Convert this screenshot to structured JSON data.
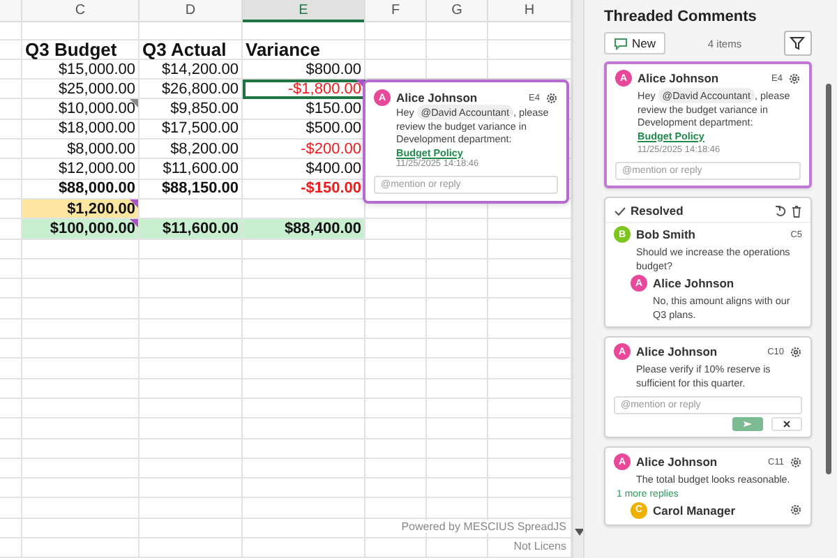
{
  "sheet": {
    "columns": [
      {
        "label": "C",
        "selected": false
      },
      {
        "label": "D",
        "selected": false
      },
      {
        "label": "E",
        "selected": true
      },
      {
        "label": "F",
        "selected": false
      },
      {
        "label": "G",
        "selected": false
      },
      {
        "label": "H",
        "selected": false
      }
    ],
    "rows": [
      {
        "kind": "title",
        "cells": [
          {
            "text": "Q3 Budget"
          },
          {
            "text": "Q3 Actual"
          },
          {
            "text": "Variance"
          }
        ]
      },
      {
        "kind": "data",
        "cells": [
          {
            "text": "$15,000.00"
          },
          {
            "text": "$14,200.00"
          },
          {
            "text": "$800.00"
          }
        ]
      },
      {
        "kind": "data",
        "cells": [
          {
            "text": "$25,000.00"
          },
          {
            "text": "$26,800.00"
          },
          {
            "text": "-$1,800.00",
            "negative": true,
            "selected": true,
            "comment": true,
            "resolved": false
          }
        ]
      },
      {
        "kind": "data",
        "cells": [
          {
            "text": "$10,000.00",
            "comment": true,
            "resolved": true
          },
          {
            "text": "$9,850.00"
          },
          {
            "text": "$150.00"
          }
        ]
      },
      {
        "kind": "data",
        "cells": [
          {
            "text": "$18,000.00"
          },
          {
            "text": "$17,500.00"
          },
          {
            "text": "$500.00"
          }
        ]
      },
      {
        "kind": "data",
        "cells": [
          {
            "text": "$8,000.00"
          },
          {
            "text": "$8,200.00"
          },
          {
            "text": "-$200.00",
            "negative": true
          }
        ]
      },
      {
        "kind": "data",
        "cells": [
          {
            "text": "$12,000.00"
          },
          {
            "text": "$11,600.00"
          },
          {
            "text": "$400.00"
          }
        ]
      },
      {
        "kind": "total",
        "cells": [
          {
            "text": "$88,000.00"
          },
          {
            "text": "$88,150.00"
          },
          {
            "text": "-$150.00",
            "negative": true
          }
        ]
      },
      {
        "kind": "total",
        "cells": [
          {
            "text": "$1,200.00",
            "color": "#fde6a0",
            "comment": true,
            "resolved": false
          }
        ]
      },
      {
        "kind": "total",
        "cells": [
          {
            "text": "$100,000.00",
            "color": "#c8efd0",
            "comment": true,
            "resolved": false
          },
          {
            "text": "$11,600.00",
            "color": "#c8efd0"
          },
          {
            "text": "$88,400.00",
            "color": "#c8efd0"
          }
        ]
      }
    ],
    "comment_popup": {
      "author": {
        "name": "Alice Johnson",
        "initial": "A",
        "color": "#e8489a"
      },
      "cell": "E4",
      "body": [
        {
          "kind": "text",
          "text": "Hey "
        },
        {
          "kind": "mention",
          "text": "@David Accountant"
        },
        {
          "kind": "text",
          "text": ", please review the budget variance in Development department: "
        },
        {
          "kind": "link",
          "text": "Budget Policy"
        }
      ],
      "time": "11/25/2025 14:18:46",
      "reply_placeholder": "@mention or reply"
    },
    "watermark": [
      "Powered by MESCIUS SpreadJS",
      "Not Licens"
    ]
  },
  "panel": {
    "title": "Threaded Comments",
    "new_button": "New",
    "count": "4 items",
    "threads": [
      {
        "kind": "active",
        "author": {
          "name": "Alice Johnson",
          "initial": "A",
          "color": "#e8489a"
        },
        "cell": "E4",
        "body": [
          {
            "kind": "text",
            "text": "Hey "
          },
          {
            "kind": "mention",
            "text": "@David Accountant"
          },
          {
            "kind": "text",
            "text": ", please review the budget variance in Development department: "
          },
          {
            "kind": "link",
            "text": "Budget Policy"
          }
        ],
        "time": "11/25/2025 14:18:46",
        "reply_placeholder": "@mention or reply"
      },
      {
        "kind": "resolved",
        "status": "Resolved",
        "author": {
          "name": "Bob Smith",
          "initial": "B",
          "color": "#7cc41e"
        },
        "cell": "C5",
        "body": [
          {
            "kind": "text",
            "text": "Should we increase the operations budget?"
          }
        ],
        "replies": [
          {
            "author": {
              "name": "Alice Johnson",
              "initial": "A",
              "color": "#e8489a"
            },
            "body": "No, this amount aligns with our Q3 plans."
          }
        ]
      },
      {
        "kind": "editing",
        "author": {
          "name": "Alice Johnson",
          "initial": "A",
          "color": "#e8489a"
        },
        "cell": "C10",
        "body": [
          {
            "kind": "text",
            "text": "Please verify if 10% reserve is sufficient for this quarter."
          }
        ],
        "reply_placeholder": "@mention or reply"
      },
      {
        "kind": "plain",
        "author": {
          "name": "Alice Johnson",
          "initial": "A",
          "color": "#e8489a"
        },
        "cell": "C11",
        "body": [
          {
            "kind": "text",
            "text": "The total budget looks reasonable."
          }
        ],
        "more_replies": "1 more replies",
        "replies": [
          {
            "author": {
              "name": "Carol Manager",
              "initial": "C",
              "color": "#f0b000"
            }
          }
        ]
      }
    ]
  }
}
